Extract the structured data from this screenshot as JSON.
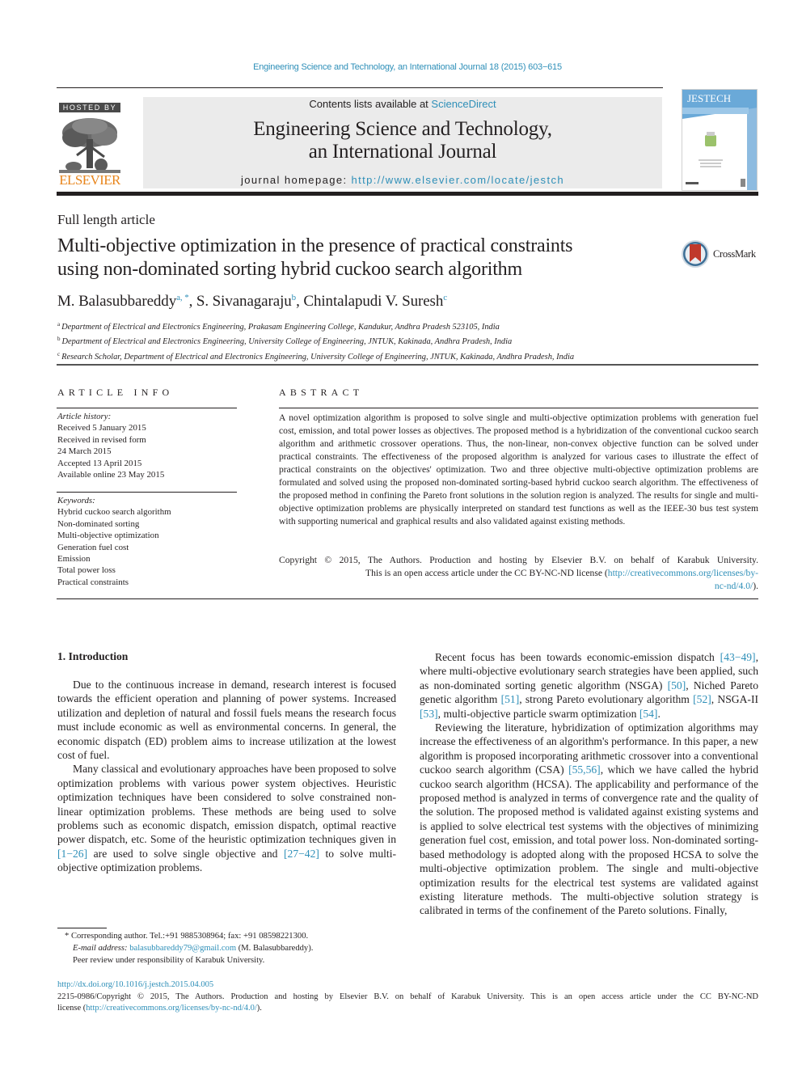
{
  "running_head": "Engineering Science and Technology, an International Journal 18 (2015) 603−615",
  "masthead": {
    "hosted_by": "HOSTED BY",
    "publisher_logo_text": "ELSEVIER",
    "contents_prefix": "Contents lists available at ",
    "contents_link": "ScienceDirect",
    "journal_title_line1": "Engineering Science and Technology,",
    "journal_title_line2": "an International Journal",
    "homepage_prefix": "journal homepage: ",
    "homepage_url": "http://www.elsevier.com/locate/jestch",
    "cover_title": "JESTECH"
  },
  "article": {
    "type": "Full length article",
    "title_line1": "Multi-objective optimization in the presence of practical constraints",
    "title_line2": "using non-dominated sorting hybrid cuckoo search algorithm",
    "crossmark_label": "CrossMark",
    "authors": [
      {
        "name": "M. Balasubbareddy",
        "sup": "a, *",
        "sep": ", "
      },
      {
        "name": "S. Sivanagaraju",
        "sup": "b",
        "sep": ", "
      },
      {
        "name": "Chintalapudi V. Suresh",
        "sup": "c",
        "sep": ""
      }
    ],
    "affiliations": [
      {
        "mark": "a",
        "text": "Department of Electrical and Electronics Engineering, Prakasam Engineering College, Kandukur, Andhra Pradesh 523105, India"
      },
      {
        "mark": "b",
        "text": "Department of Electrical and Electronics Engineering, University College of Engineering, JNTUK, Kakinada, Andhra Pradesh, India"
      },
      {
        "mark": "c",
        "text": "Research Scholar, Department of Electrical and Electronics Engineering, University College of Engineering, JNTUK, Kakinada, Andhra Pradesh, India"
      }
    ]
  },
  "article_info": {
    "heading": "ARTICLE INFO",
    "history_label": "Article history:",
    "history": [
      "Received 5 January 2015",
      "Received in revised form",
      "24 March 2015",
      "Accepted 13 April 2015",
      "Available online 23 May 2015"
    ],
    "keywords_label": "Keywords:",
    "keywords": [
      "Hybrid cuckoo search algorithm",
      "Non-dominated sorting",
      "Multi-objective optimization",
      "Generation fuel cost",
      "Emission",
      "Total power loss",
      "Practical constraints"
    ]
  },
  "abstract": {
    "heading": "ABSTRACT",
    "text": "A novel optimization algorithm is proposed to solve single and multi-objective optimization problems with generation fuel cost, emission, and total power losses as objectives. The proposed method is a hybridization of the conventional cuckoo search algorithm and arithmetic crossover operations. Thus, the non-linear, non-convex objective function can be solved under practical constraints. The effectiveness of the proposed algorithm is analyzed for various cases to illustrate the effect of practical constraints on the objectives' optimization. Two and three objective multi-objective optimization problems are formulated and solved using the proposed non-dominated sorting-based hybrid cuckoo search algorithm. The effectiveness of the proposed method in confining the Pareto front solutions in the solution region is analyzed. The results for single and multi-objective optimization problems are physically interpreted on standard test functions as well as the IEEE-30 bus test system with supporting numerical and graphical results and also validated against existing methods.",
    "copyright_line1": "Copyright © 2015, The Authors. Production and hosting by Elsevier B.V. on behalf of Karabuk University.",
    "copyright_line2_prefix": "This is an open access article under the CC BY-NC-ND license (",
    "license_url_part1": "http://creativecommons.org/licenses/by-",
    "license_url_part2": "nc-nd/4.0/",
    "copyright_suffix": ")."
  },
  "body": {
    "section_heading": "1.  Introduction",
    "left_paragraphs": [
      {
        "segments": [
          {
            "t": "Due to the continuous increase in demand, research interest is focused towards the efficient operation and planning of power systems. Increased utilization and depletion of natural and fossil fuels means the research focus must include economic as well as environmental concerns. In general, the economic dispatch (ED) problem aims to increase utilization at the lowest cost of fuel."
          }
        ]
      },
      {
        "segments": [
          {
            "t": "Many classical and evolutionary approaches have been proposed to solve optimization problems with various power system objectives. Heuristic optimization techniques have been considered to solve constrained non-linear optimization problems. These methods are being used to solve problems such as economic dispatch, emission dispatch, optimal reactive power dispatch, etc. Some of the heuristic optimization techniques given in "
          },
          {
            "t": "[1−26]",
            "ref": true
          },
          {
            "t": " are used to solve single objective and "
          },
          {
            "t": "[27−42]",
            "ref": true
          },
          {
            "t": " to solve multi-objective optimization problems."
          }
        ]
      }
    ],
    "right_paragraphs": [
      {
        "segments": [
          {
            "t": "Recent focus has been towards economic-emission dispatch "
          },
          {
            "t": "[43−49]",
            "ref": true
          },
          {
            "t": ", where multi-objective evolutionary search strategies have been applied, such as non-dominated sorting genetic algorithm (NSGA) "
          },
          {
            "t": "[50]",
            "ref": true
          },
          {
            "t": ", Niched Pareto genetic algorithm "
          },
          {
            "t": "[51]",
            "ref": true
          },
          {
            "t": ", strong Pareto evolutionary algorithm "
          },
          {
            "t": "[52]",
            "ref": true
          },
          {
            "t": ", NSGA-II "
          },
          {
            "t": "[53]",
            "ref": true
          },
          {
            "t": ", multi-objective particle swarm optimization "
          },
          {
            "t": "[54]",
            "ref": true
          },
          {
            "t": "."
          }
        ]
      },
      {
        "segments": [
          {
            "t": "Reviewing the literature, hybridization of optimization algorithms may increase the effectiveness of an algorithm's performance. In this paper, a new algorithm is proposed incorporating arithmetic crossover into a conventional cuckoo search algorithm (CSA) "
          },
          {
            "t": "[55,56]",
            "ref": true
          },
          {
            "t": ", which we have called the hybrid cuckoo search algorithm (HCSA). The applicability and performance of the proposed method is analyzed in terms of convergence rate and the quality of the solution. The proposed method is validated against existing systems and is applied to solve electrical test systems with the objectives of minimizing generation fuel cost, emission, and total power loss. Non-dominated sorting-based methodology is adopted along with the proposed HCSA to solve the multi-objective optimization problem. The single and multi-objective optimization results for the electrical test systems are validated against existing literature methods. The multi-objective solution strategy is calibrated in terms of the confinement of the Pareto solutions. Finally,"
          }
        ]
      }
    ]
  },
  "footnotes": {
    "corresponding": "*  Corresponding author. Tel.:+91 9885308964; fax: +91 08598221300.",
    "email_label": "E-mail address: ",
    "email": "balasubbareddy79@gmail.com",
    "email_suffix": " (M. Balasubbareddy).",
    "peer_review": "Peer review under responsibility of Karabuk University."
  },
  "bottom": {
    "doi_url": "http://dx.doi.org/10.1016/j.jestch.2015.04.005",
    "issn_copyright": "2215-0986/Copyright © 2015, The Authors. Production and hosting by Elsevier B.V. on behalf of Karabuk University. This is an open access article under the CC BY-NC-ND",
    "license_prefix": "license (",
    "license_url": "http://creativecommons.org/licenses/by-nc-nd/4.0/",
    "license_suffix": ")."
  }
}
